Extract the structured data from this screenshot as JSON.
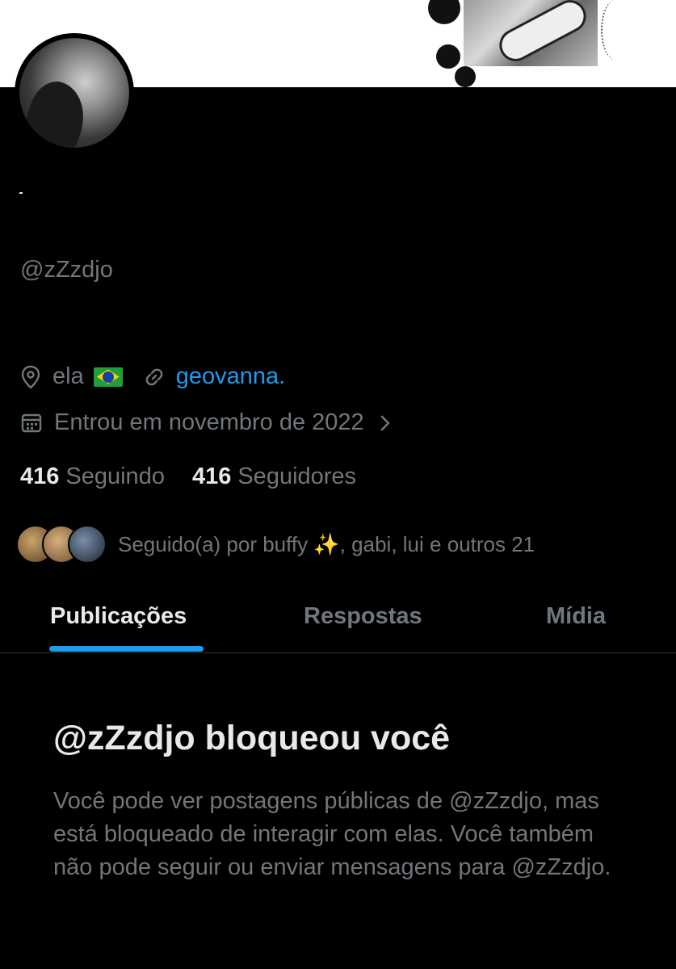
{
  "profile": {
    "display_name": ".",
    "handle": "@zZzdjo",
    "location": "ela",
    "location_flag": "brazil-flag-icon",
    "website": "geovanna.",
    "joined": "Entrou em novembro de 2022",
    "following_count": "416",
    "following_label": "Seguindo",
    "followers_count": "416",
    "followers_label": "Seguidores",
    "followed_by_prefix": "Seguido(a) por buffy",
    "followed_by_sparkle": "✨",
    "followed_by_suffix": ", gabi, lui e outros 21"
  },
  "tabs": [
    {
      "label": "Publicações",
      "active": true
    },
    {
      "label": "Respostas",
      "active": false
    },
    {
      "label": "Mídia",
      "active": false
    }
  ],
  "blocked": {
    "title": "@zZzdjo bloqueou você",
    "description": "Você pode ver postagens públicas de @zZzdjo, mas está bloqueado de interagir com elas. Você também não pode seguir ou enviar mensagens para @zZzdjo."
  },
  "colors": {
    "background": "#000000",
    "text_primary": "#e7e9ea",
    "text_secondary": "#71767b",
    "accent": "#1d9bf0",
    "divider": "#2f3336"
  }
}
